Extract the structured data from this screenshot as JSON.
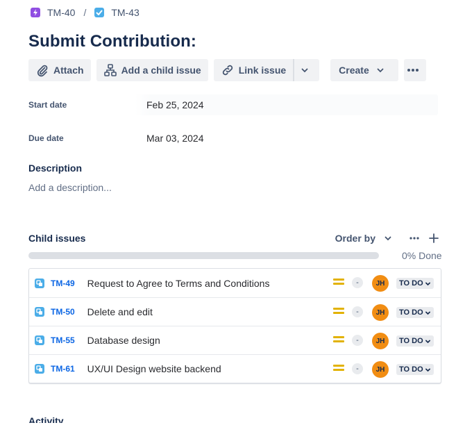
{
  "breadcrumb": {
    "parent_key": "TM-40",
    "parent_icon": "lightning-epic-icon",
    "separator": "/",
    "current_key": "TM-43",
    "current_icon": "checkbox-task-icon"
  },
  "issue": {
    "title": "Submit Contribution:"
  },
  "toolbar": {
    "attach_label": "Attach",
    "add_child_label": "Add a child issue",
    "link_issue_label": "Link issue",
    "create_label": "Create"
  },
  "fields": {
    "start_date_label": "Start date",
    "start_date_value": "Feb 25, 2024",
    "due_date_label": "Due date",
    "due_date_value": "Mar 03, 2024"
  },
  "description": {
    "label": "Description",
    "placeholder": "Add a description..."
  },
  "child_issues": {
    "title": "Child issues",
    "order_by_label": "Order by",
    "progress_percent": 0,
    "progress_text": "0% Done",
    "items": [
      {
        "key": "TM-49",
        "summary": "Request to Agree to Terms and Conditions",
        "estimate": "-",
        "assignee_initials": "JH",
        "status": "TO DO"
      },
      {
        "key": "TM-50",
        "summary": "Delete and edit",
        "estimate": "-",
        "assignee_initials": "JH",
        "status": "TO DO"
      },
      {
        "key": "TM-55",
        "summary": "Database design",
        "estimate": "-",
        "assignee_initials": "JH",
        "status": "TO DO"
      },
      {
        "key": "TM-61",
        "summary": "UX/UI Design website backend",
        "estimate": "-",
        "assignee_initials": "JH",
        "status": "TO DO"
      }
    ]
  },
  "activity": {
    "label": "Activity"
  },
  "colors": {
    "epic": "#904ee2",
    "subtask": "#4bade8",
    "link": "#0c66e4",
    "priority_medium": "#e2b203",
    "avatar": "#f18d13"
  }
}
